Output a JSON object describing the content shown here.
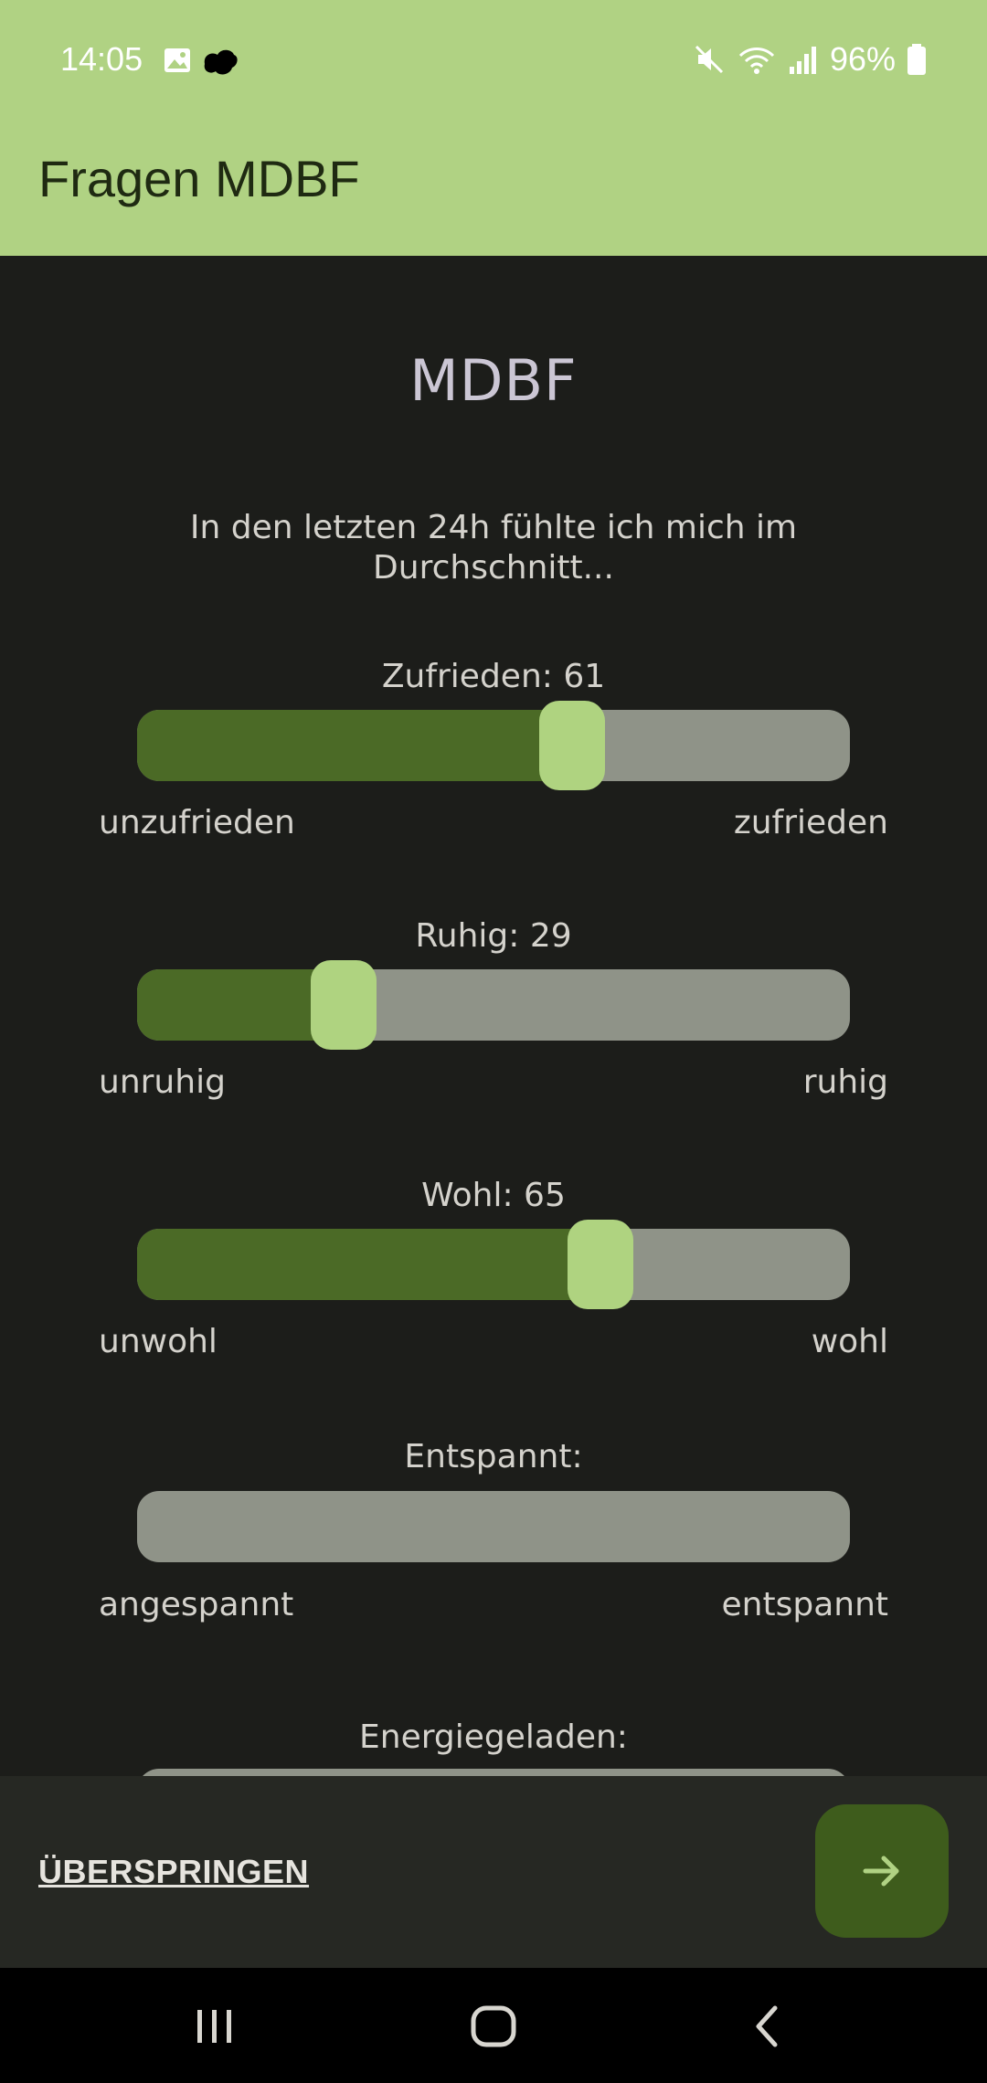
{
  "status_bar": {
    "time": "14:05",
    "battery": "96%",
    "icons": [
      "image-icon",
      "app-notification-icon",
      "mute-icon",
      "wifi-icon",
      "signal-icon",
      "battery-icon"
    ]
  },
  "app_bar": {
    "title": "Fragen MDBF"
  },
  "page": {
    "heading": "MDBF",
    "intro": "In den letzten 24h fühlte ich mich im Durchschnitt..."
  },
  "questions": [
    {
      "label": "Zufrieden: 61",
      "value": 61,
      "min_label": "unzufrieden",
      "max_label": "zufrieden"
    },
    {
      "label": "Ruhig: 29",
      "value": 29,
      "min_label": "unruhig",
      "max_label": "ruhig"
    },
    {
      "label": "Wohl: 65",
      "value": 65,
      "min_label": "unwohl",
      "max_label": "wohl"
    },
    {
      "label": "Entspannt:",
      "value": null,
      "min_label": "angespannt",
      "max_label": "entspannt"
    },
    {
      "label": "Energiegeladen:",
      "value": null
    }
  ],
  "actions": {
    "skip_label": "ÜBERSPRINGEN",
    "next_icon": "arrow-right-icon"
  },
  "nav_bar": {
    "icons": [
      "recent-apps-icon",
      "home-icon",
      "back-icon"
    ]
  },
  "colors": {
    "app_bar": "#b0d283",
    "background": "#1c1d1a",
    "slider_fill": "#4b6a26",
    "slider_track": "#8f9388",
    "slider_thumb": "#afd380",
    "fab": "#3e5c1c"
  }
}
